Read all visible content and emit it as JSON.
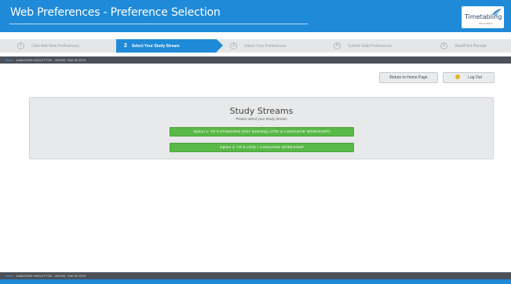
{
  "header": {
    "title": "Web Preferences - Preference Selection",
    "logo_text": "Timetabling",
    "logo_sub": "SOLUTIONS"
  },
  "steps": [
    {
      "num": "1",
      "label": "Click Add New Preferences",
      "active": false
    },
    {
      "num": "2",
      "label": "Select Your Study Stream",
      "active": true
    },
    {
      "num": "3",
      "label": "Select Your Preferences",
      "active": false
    },
    {
      "num": "4",
      "label": "Submit Valid Preferences",
      "active": false
    },
    {
      "num": "5",
      "label": "View/Print Receipt",
      "active": false
    }
  ],
  "info": {
    "label": "Name:",
    "value": "AAMC0000 HAGLETTOK - 201000, Year 09 2019"
  },
  "buttons": {
    "home": "Return to Home Page",
    "logout": "Log Out"
  },
  "panel": {
    "heading": "Study Streams",
    "subheading": "Please select your Study Stream",
    "options": [
      "Option 1: YR 9 STANDARD (NOT Selecting LOTE or LANGUAGE WORKSHOP)",
      "Option 2: YR 9 LOTE / LANGUAGE WORKSHOP"
    ]
  },
  "colors": {
    "brand_blue": "#1f8ad8",
    "option_green": "#59b947",
    "dark_strip": "#4b5158"
  }
}
